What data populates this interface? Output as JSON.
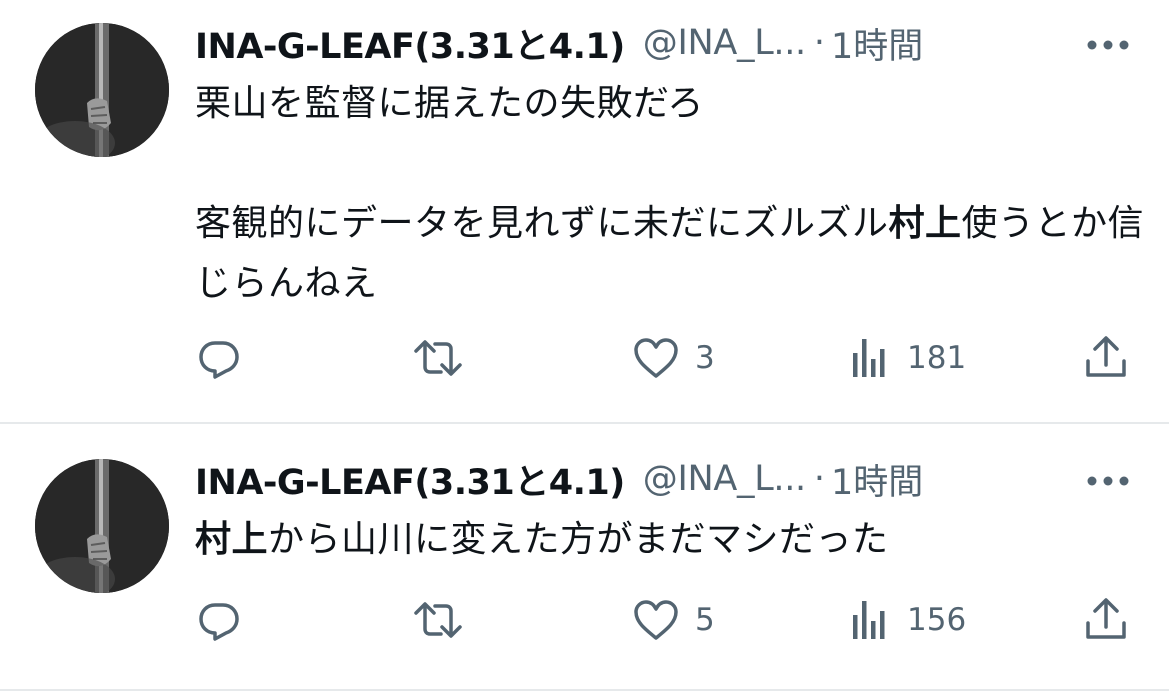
{
  "tweets": [
    {
      "author_name": "INA-G-LEAF(3.31と4.1)",
      "handle": "@INA_L...",
      "separator": "·",
      "time": "1時間",
      "body": [
        {
          "text": "栗山を監督に据えたの失敗だろ",
          "bold": false
        },
        {
          "text": "\n\n客観的にデータを見れずに未だにズルズル",
          "bold": false
        },
        {
          "text": "村上",
          "bold": true
        },
        {
          "text": "使うとか信じらんねえ",
          "bold": false
        }
      ],
      "actions": {
        "reply_icon": "reply-icon",
        "retweet_icon": "retweet-icon",
        "like_icon": "heart-icon",
        "like_count": "3",
        "views_icon": "views-icon",
        "views_count": "181",
        "share_icon": "share-icon"
      }
    },
    {
      "author_name": "INA-G-LEAF(3.31と4.1)",
      "handle": "@INA_L...",
      "separator": "·",
      "time": "1時間",
      "body": [
        {
          "text": "村上",
          "bold": true
        },
        {
          "text": "から山川に変えた方がまだマシだった",
          "bold": false
        }
      ],
      "actions": {
        "reply_icon": "reply-icon",
        "retweet_icon": "retweet-icon",
        "like_icon": "heart-icon",
        "like_count": "5",
        "views_icon": "views-icon",
        "views_count": "156",
        "share_icon": "share-icon"
      }
    }
  ],
  "colors": {
    "text_primary": "#0f1419",
    "text_secondary": "#536471",
    "divider": "#e6e9eb",
    "background": "#ffffff"
  }
}
